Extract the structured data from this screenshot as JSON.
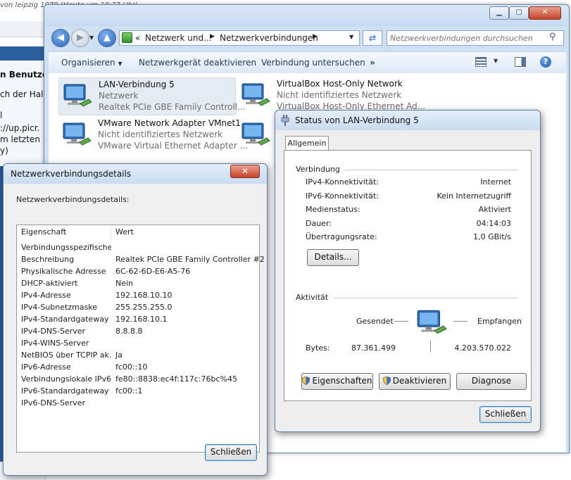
{
  "background_page": {
    "top_text": "von leipzig 1979 (Heute um 10:27 Uhr)",
    "lines": [
      {
        "text": "n Benutze",
        "bold": true
      },
      {
        "text": "ch der Hal",
        "bold": false
      },
      {
        "text": "l",
        "bold": false
      },
      {
        "text": "://up.picr.",
        "bold": false
      },
      {
        "text": "m letzten",
        "bold": false
      },
      {
        "text": "y)",
        "bold": false
      }
    ]
  },
  "explorer": {
    "breadcrumb": [
      "Netzwerk und...",
      "Netzwerkverbindungen"
    ],
    "search_placeholder": "Netzwerkverbindungen durchsuchen",
    "toolbar": {
      "organize": "Organisieren",
      "disable_device": "Netzwerkgerät deaktivieren",
      "diagnose_connection": "Verbindung untersuchen",
      "more": "»"
    },
    "connections": [
      {
        "name": "LAN-Verbindung 5",
        "status": "Netzwerk",
        "device": "Realtek PCIe GBE Family Controll...",
        "selected": true
      },
      {
        "name": "VirtualBox Host-Only Network",
        "status": "Nicht identifiziertes Netzwerk",
        "device": "VirtualBox Host-Only Ethernet Ad..."
      },
      {
        "name": "VMware Network Adapter VMnet1",
        "status": "Nicht identifiziertes Netzwerk",
        "device": "VMware Virtual Ethernet Adapter ..."
      },
      {
        "name": "",
        "status": "",
        "device": ""
      }
    ]
  },
  "details_dialog": {
    "title": "Netzwerkverbindungsdetails",
    "heading": "Netzwerkverbindungsdetails:",
    "columns": [
      "Eigenschaft",
      "Wert"
    ],
    "rows": [
      {
        "k": "Verbindungsspezifisches...",
        "v": ""
      },
      {
        "k": "Beschreibung",
        "v": "Realtek PCIe GBE Family Controller #2"
      },
      {
        "k": "Physikalische Adresse",
        "v": "6C-62-6D-E6-A5-76"
      },
      {
        "k": "DHCP-aktiviert",
        "v": "Nein"
      },
      {
        "k": "IPv4-Adresse",
        "v": "192.168.10.10"
      },
      {
        "k": "IPv4-Subnetzmaske",
        "v": "255.255.255.0"
      },
      {
        "k": "IPv4-Standardgateway",
        "v": "192.168.10.1"
      },
      {
        "k": "IPv4-DNS-Server",
        "v": "8.8.8.8"
      },
      {
        "k": "IPv4-WINS-Server",
        "v": ""
      },
      {
        "k": "NetBIOS über TCPIP ak...",
        "v": "Ja"
      },
      {
        "k": "IPv6-Adresse",
        "v": "fc00::10"
      },
      {
        "k": "Verbindungslokale IPv6-...",
        "v": "fe80::8838:ec4f:117c:76bc%45"
      },
      {
        "k": "IPv6-Standardgateway",
        "v": "fc00::1"
      },
      {
        "k": "IPv6-DNS-Server",
        "v": ""
      }
    ],
    "close_label": "Schließen",
    "close_glyph": "✕"
  },
  "status_dialog": {
    "title": "Status von LAN-Verbindung 5",
    "tab": "Allgemein",
    "connection_group": "Verbindung",
    "fields": [
      {
        "label": "IPv4-Konnektivität:",
        "value": "Internet"
      },
      {
        "label": "IPv6-Konnektivität:",
        "value": "Kein Internetzugriff"
      },
      {
        "label": "Medienstatus:",
        "value": "Aktiviert"
      },
      {
        "label": "Dauer:",
        "value": "04:14:03"
      },
      {
        "label": "Übertragungsrate:",
        "value": "1,0 GBit/s"
      }
    ],
    "details_button": "Details...",
    "activity_group": "Aktivität",
    "sent_label": "Gesendet",
    "received_label": "Empfangen",
    "bytes_label": "Bytes:",
    "bytes_sent": "87.361.499",
    "bytes_received": "4.203.570.022",
    "properties_button": "Eigenschaften",
    "disable_button": "Deaktivieren",
    "diagnose_button": "Diagnose",
    "close_button": "Schließen"
  },
  "colors": {
    "accent": "#2b63b8",
    "title_gradient_top": "#e3edf8",
    "close_red": "#c7432b"
  }
}
